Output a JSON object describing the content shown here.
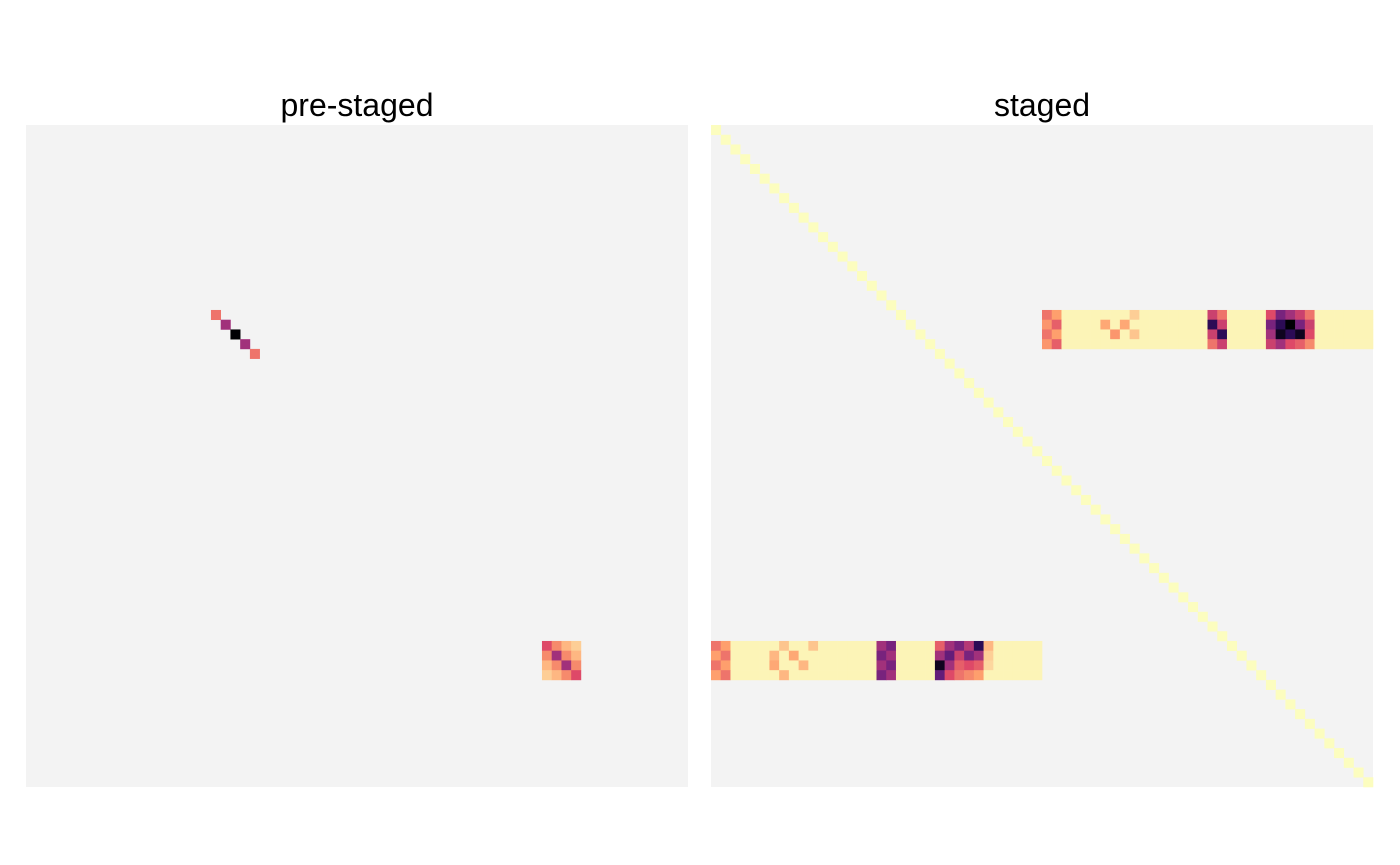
{
  "chart_data": [
    {
      "type": "heatmap",
      "title": "pre-staged",
      "background": "#f3f3f3",
      "colormap": [
        "#000004",
        "#3b0f70",
        "#8c2981",
        "#de4968",
        "#fe9f6d",
        "#fcfdbf"
      ],
      "n": 68,
      "cells": [
        [
          19,
          19,
          0.3
        ],
        [
          20,
          20,
          0.55
        ],
        [
          21,
          21,
          1.0
        ],
        [
          22,
          22,
          0.55
        ],
        [
          23,
          23,
          0.3
        ],
        [
          53,
          53,
          0.4
        ],
        [
          53,
          54,
          0.25
        ],
        [
          53,
          55,
          0.15
        ],
        [
          53,
          56,
          0.1
        ],
        [
          54,
          53,
          0.25
        ],
        [
          54,
          54,
          0.55
        ],
        [
          54,
          55,
          0.25
        ],
        [
          54,
          56,
          0.15
        ],
        [
          55,
          53,
          0.15
        ],
        [
          55,
          54,
          0.25
        ],
        [
          55,
          55,
          0.55
        ],
        [
          55,
          56,
          0.25
        ],
        [
          56,
          53,
          0.1
        ],
        [
          56,
          54,
          0.15
        ],
        [
          56,
          55,
          0.25
        ],
        [
          56,
          56,
          0.4
        ]
      ]
    },
    {
      "type": "heatmap",
      "title": "staged",
      "background": "#f3f3f3",
      "colormap": [
        "#000004",
        "#3b0f70",
        "#8c2981",
        "#de4968",
        "#fe9f6d",
        "#fcfdbf"
      ],
      "n": 68,
      "diagonal_value": 0.0,
      "row_bands": [
        {
          "rows": [
            19,
            22
          ],
          "cols": [
            34,
            67
          ],
          "base": 0.02,
          "hot": [
            [
              19,
              34,
              0.3
            ],
            [
              20,
              34,
              0.22
            ],
            [
              21,
              34,
              0.3
            ],
            [
              22,
              34,
              0.22
            ],
            [
              19,
              35,
              0.2
            ],
            [
              20,
              35,
              0.35
            ],
            [
              21,
              35,
              0.2
            ],
            [
              22,
              35,
              0.35
            ],
            [
              20,
              40,
              0.18
            ],
            [
              21,
              41,
              0.22
            ],
            [
              20,
              42,
              0.18
            ],
            [
              19,
              43,
              0.1
            ],
            [
              21,
              43,
              0.12
            ],
            [
              19,
              51,
              0.45
            ],
            [
              20,
              51,
              0.85
            ],
            [
              21,
              51,
              0.45
            ],
            [
              22,
              51,
              0.3
            ],
            [
              19,
              52,
              0.3
            ],
            [
              20,
              52,
              0.45
            ],
            [
              21,
              52,
              0.85
            ],
            [
              22,
              52,
              0.45
            ],
            [
              19,
              57,
              0.4
            ],
            [
              20,
              57,
              0.65
            ],
            [
              21,
              57,
              0.55
            ],
            [
              22,
              57,
              0.45
            ],
            [
              19,
              58,
              0.65
            ],
            [
              20,
              58,
              0.85
            ],
            [
              21,
              58,
              0.95
            ],
            [
              22,
              58,
              0.55
            ],
            [
              19,
              59,
              0.55
            ],
            [
              20,
              59,
              1.0
            ],
            [
              21,
              59,
              0.85
            ],
            [
              22,
              59,
              0.4
            ],
            [
              19,
              60,
              0.45
            ],
            [
              20,
              60,
              0.65
            ],
            [
              21,
              60,
              0.95
            ],
            [
              22,
              60,
              0.35
            ],
            [
              19,
              61,
              0.3
            ],
            [
              20,
              61,
              0.45
            ],
            [
              21,
              61,
              0.4
            ],
            [
              22,
              61,
              0.25
            ]
          ]
        },
        {
          "rows": [
            53,
            56
          ],
          "cols": [
            0,
            33
          ],
          "base": 0.02,
          "hot": [
            [
              53,
              0,
              0.3
            ],
            [
              54,
              0,
              0.2
            ],
            [
              55,
              0,
              0.3
            ],
            [
              56,
              0,
              0.2
            ],
            [
              53,
              1,
              0.2
            ],
            [
              54,
              1,
              0.3
            ],
            [
              55,
              1,
              0.2
            ],
            [
              56,
              1,
              0.3
            ],
            [
              54,
              6,
              0.15
            ],
            [
              55,
              6,
              0.18
            ],
            [
              53,
              7,
              0.12
            ],
            [
              56,
              7,
              0.15
            ],
            [
              54,
              8,
              0.18
            ],
            [
              55,
              9,
              0.15
            ],
            [
              53,
              10,
              0.12
            ],
            [
              53,
              17,
              0.55
            ],
            [
              54,
              17,
              0.65
            ],
            [
              55,
              17,
              0.55
            ],
            [
              56,
              17,
              0.65
            ],
            [
              53,
              18,
              0.65
            ],
            [
              54,
              18,
              0.55
            ],
            [
              55,
              18,
              0.65
            ],
            [
              56,
              18,
              0.55
            ],
            [
              53,
              23,
              0.35
            ],
            [
              54,
              23,
              0.55
            ],
            [
              55,
              23,
              0.95
            ],
            [
              56,
              23,
              0.7
            ],
            [
              53,
              24,
              0.55
            ],
            [
              54,
              24,
              0.7
            ],
            [
              55,
              24,
              0.55
            ],
            [
              56,
              24,
              0.4
            ],
            [
              53,
              25,
              0.65
            ],
            [
              54,
              25,
              0.45
            ],
            [
              55,
              25,
              0.35
            ],
            [
              56,
              25,
              0.3
            ],
            [
              53,
              26,
              0.5
            ],
            [
              54,
              26,
              0.65
            ],
            [
              55,
              26,
              0.4
            ],
            [
              56,
              26,
              0.25
            ],
            [
              53,
              27,
              0.85
            ],
            [
              54,
              27,
              0.55
            ],
            [
              55,
              27,
              0.35
            ],
            [
              56,
              27,
              0.2
            ],
            [
              53,
              28,
              0.15
            ],
            [
              54,
              28,
              0.1
            ],
            [
              55,
              28,
              0.08
            ]
          ]
        }
      ]
    }
  ]
}
